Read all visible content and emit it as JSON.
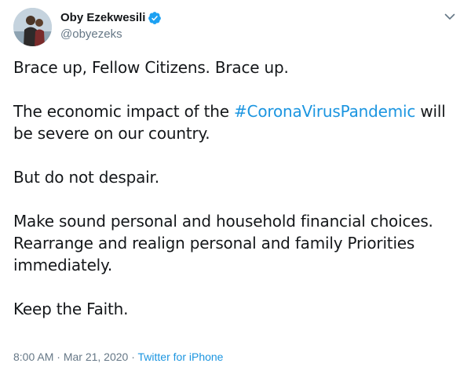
{
  "author": {
    "display_name": "Oby Ezekwesili",
    "handle": "@obyezeks",
    "verified": true
  },
  "tweet": {
    "line1": "Brace up, Fellow Citizens. Brace up.",
    "p2_before": "The economic impact of the ",
    "hashtag": "#CoronaVirusPandemic",
    "p2_after": " will be severe on our country.",
    "line3": "But do not despair.",
    "line4": "Make sound personal and household financial choices. Rearrange and realign personal and family Priorities immediately.",
    "line5": "Keep the Faith."
  },
  "meta": {
    "time": "8:00 AM",
    "separator1": " · ",
    "date": "Mar 21, 2020",
    "separator2": " · ",
    "source": "Twitter for iPhone"
  },
  "colors": {
    "link": "#1b95e0",
    "secondary_text": "#657786",
    "primary_text": "#14171a",
    "verified_badge": "#1da1f2"
  },
  "icons": {
    "verified": "verified-badge-icon",
    "menu": "chevron-down-icon"
  }
}
